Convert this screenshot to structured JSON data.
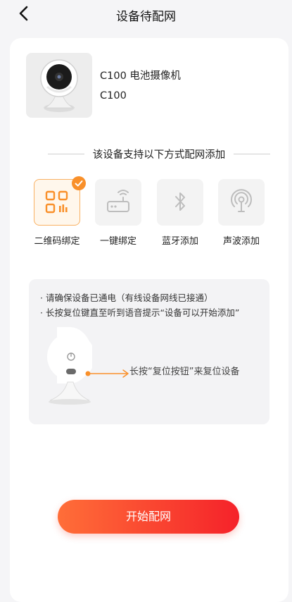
{
  "header": {
    "title": "设备待配网",
    "back_icon": "chevron-left-icon"
  },
  "device": {
    "name": "C100 电池摄像机",
    "model": "C100"
  },
  "section_title": "该设备支持以下方式配网添加",
  "methods": [
    {
      "label": "二维码绑定",
      "icon": "qr-code-icon",
      "selected": true
    },
    {
      "label": "一键绑定",
      "icon": "router-icon",
      "selected": false
    },
    {
      "label": "蓝牙添加",
      "icon": "bluetooth-icon",
      "selected": false
    },
    {
      "label": "声波添加",
      "icon": "sound-wave-icon",
      "selected": false
    }
  ],
  "tips": [
    "· 请确保设备已通电（有线设备网线已接通）",
    "· 长按复位键直至听到语音提示“设备可以开始添加”"
  ],
  "reset_hint": "长按“复位按钮”来复位设备",
  "start_button": "开始配网",
  "colors": {
    "accent": "#f9902a",
    "button_start": "#ff6e38",
    "button_end": "#f5222a"
  }
}
